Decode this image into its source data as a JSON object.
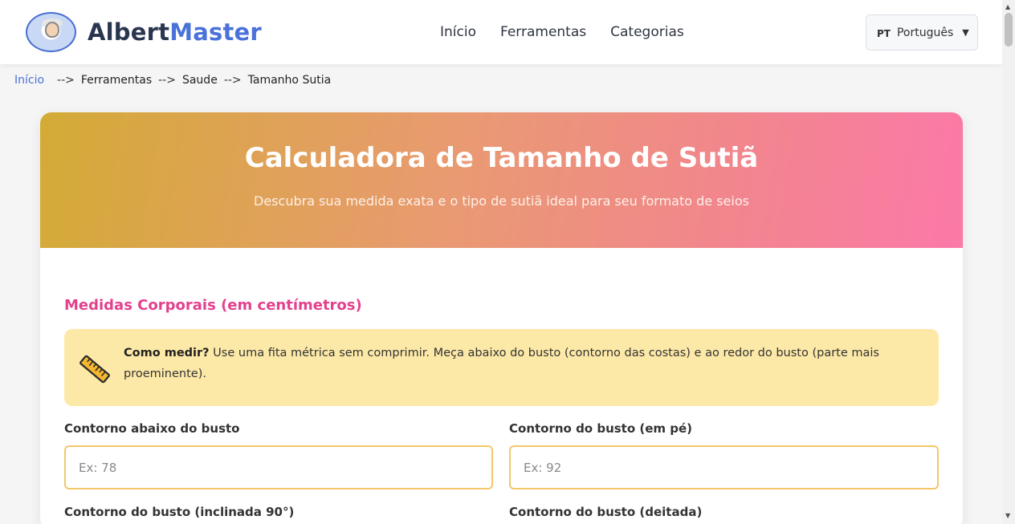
{
  "header": {
    "logo_part1": "Albert",
    "logo_part2": "Master",
    "nav": [
      "Início",
      "Ferramentas",
      "Categorias"
    ],
    "lang_code": "PT",
    "lang_label": "Português",
    "lang_arrow": "▼"
  },
  "breadcrumb": {
    "home": "Início",
    "sep": "-->",
    "items": [
      "Ferramentas",
      "Saude",
      "Tamanho Sutia"
    ]
  },
  "hero": {
    "title": "Calculadora de Tamanho de Sutiã",
    "subtitle": "Descubra sua medida exata e o tipo de sutiã ideal para seu formato de seios"
  },
  "form": {
    "section_title": "Medidas Corporais (em centímetros)",
    "tip_bold": "Como medir?",
    "tip_text": " Use uma fita métrica sem comprimir. Meça abaixo do busto (contorno das costas) e ao redor do busto (parte mais proeminente).",
    "fields": [
      {
        "label": "Contorno abaixo do busto",
        "placeholder": "Ex: 78"
      },
      {
        "label": "Contorno do busto (em pé)",
        "placeholder": "Ex: 92"
      },
      {
        "label": "Contorno do busto (inclinada 90°)",
        "placeholder": ""
      },
      {
        "label": "Contorno do busto (deitada)",
        "placeholder": ""
      }
    ]
  },
  "colors": {
    "accent_blue": "#4a72d9",
    "section_pink": "#e3418d",
    "tip_bg": "#fde9a7",
    "input_border": "#f4c76a"
  }
}
